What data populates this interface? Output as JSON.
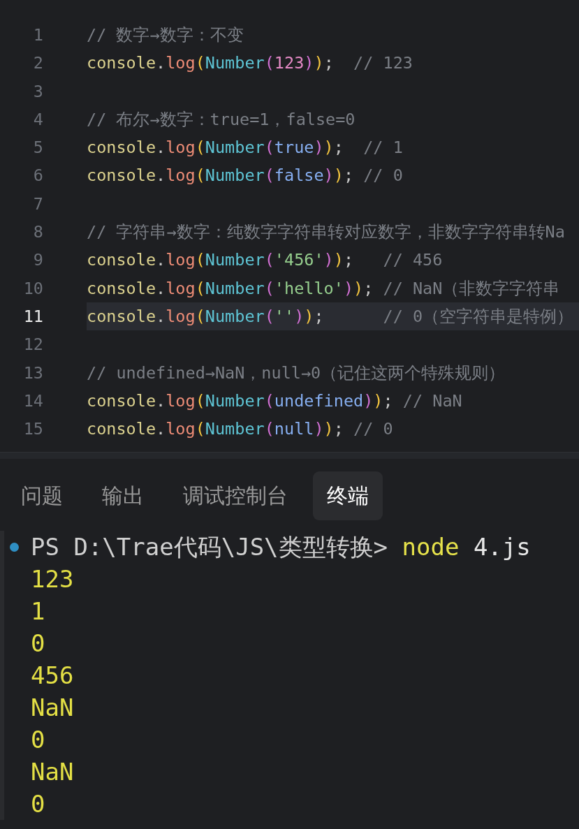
{
  "editor": {
    "lines": [
      {
        "number": "1",
        "active": false,
        "tokens": [
          {
            "kind": "comment",
            "text": "// 数字→数字：不变"
          }
        ]
      },
      {
        "number": "2",
        "active": false,
        "tokens": [
          {
            "kind": "object",
            "text": "console"
          },
          {
            "kind": "punct",
            "text": "."
          },
          {
            "kind": "method",
            "text": "log"
          },
          {
            "kind": "paren",
            "text": "("
          },
          {
            "kind": "func",
            "text": "Number"
          },
          {
            "kind": "subparen",
            "text": "("
          },
          {
            "kind": "number",
            "text": "123"
          },
          {
            "kind": "subparen",
            "text": ")"
          },
          {
            "kind": "paren",
            "text": ")"
          },
          {
            "kind": "punct",
            "text": ";"
          },
          {
            "kind": "comment",
            "text": "  // 123"
          }
        ]
      },
      {
        "number": "3",
        "active": false
      },
      {
        "number": "4",
        "active": false,
        "tokens": [
          {
            "kind": "comment",
            "text": "// 布尔→数字：true=1，false=0"
          }
        ]
      },
      {
        "number": "5",
        "active": false,
        "tokens": [
          {
            "kind": "object",
            "text": "console"
          },
          {
            "kind": "punct",
            "text": "."
          },
          {
            "kind": "method",
            "text": "log"
          },
          {
            "kind": "paren",
            "text": "("
          },
          {
            "kind": "func",
            "text": "Number"
          },
          {
            "kind": "subparen",
            "text": "("
          },
          {
            "kind": "literal",
            "text": "true"
          },
          {
            "kind": "subparen",
            "text": ")"
          },
          {
            "kind": "paren",
            "text": ")"
          },
          {
            "kind": "punct",
            "text": ";"
          },
          {
            "kind": "comment",
            "text": "  // 1"
          }
        ]
      },
      {
        "number": "6",
        "active": false,
        "tokens": [
          {
            "kind": "object",
            "text": "console"
          },
          {
            "kind": "punct",
            "text": "."
          },
          {
            "kind": "method",
            "text": "log"
          },
          {
            "kind": "paren",
            "text": "("
          },
          {
            "kind": "func",
            "text": "Number"
          },
          {
            "kind": "subparen",
            "text": "("
          },
          {
            "kind": "literal",
            "text": "false"
          },
          {
            "kind": "subparen",
            "text": ")"
          },
          {
            "kind": "paren",
            "text": ")"
          },
          {
            "kind": "punct",
            "text": ";"
          },
          {
            "kind": "comment",
            "text": " // 0"
          }
        ]
      },
      {
        "number": "7",
        "active": false
      },
      {
        "number": "8",
        "active": false,
        "tokens": [
          {
            "kind": "comment",
            "text": "// 字符串→数字：纯数字字符串转对应数字，非数字字符串转Na"
          }
        ]
      },
      {
        "number": "9",
        "active": false,
        "tokens": [
          {
            "kind": "object",
            "text": "console"
          },
          {
            "kind": "punct",
            "text": "."
          },
          {
            "kind": "method",
            "text": "log"
          },
          {
            "kind": "paren",
            "text": "("
          },
          {
            "kind": "func",
            "text": "Number"
          },
          {
            "kind": "subparen",
            "text": "("
          },
          {
            "kind": "string",
            "text": "'456'"
          },
          {
            "kind": "subparen",
            "text": ")"
          },
          {
            "kind": "paren",
            "text": ")"
          },
          {
            "kind": "punct",
            "text": ";"
          },
          {
            "kind": "comment",
            "text": "   // 456"
          }
        ]
      },
      {
        "number": "10",
        "active": false,
        "tokens": [
          {
            "kind": "object",
            "text": "console"
          },
          {
            "kind": "punct",
            "text": "."
          },
          {
            "kind": "method",
            "text": "log"
          },
          {
            "kind": "paren",
            "text": "("
          },
          {
            "kind": "func",
            "text": "Number"
          },
          {
            "kind": "subparen",
            "text": "("
          },
          {
            "kind": "string",
            "text": "'hello'"
          },
          {
            "kind": "subparen",
            "text": ")"
          },
          {
            "kind": "paren",
            "text": ")"
          },
          {
            "kind": "punct",
            "text": ";"
          },
          {
            "kind": "comment",
            "text": " // NaN（非数字字符串"
          }
        ]
      },
      {
        "number": "11",
        "active": true,
        "tokens": [
          {
            "kind": "object",
            "text": "console"
          },
          {
            "kind": "punct",
            "text": "."
          },
          {
            "kind": "method",
            "text": "log"
          },
          {
            "kind": "paren",
            "text": "("
          },
          {
            "kind": "func",
            "text": "Number"
          },
          {
            "kind": "subparen",
            "text": "("
          },
          {
            "kind": "string",
            "text": "''"
          },
          {
            "kind": "subparen",
            "text": ")"
          },
          {
            "kind": "paren",
            "text": ")"
          },
          {
            "kind": "punct",
            "text": ";"
          },
          {
            "kind": "comment",
            "text": "      // 0（空字符串是特例）"
          }
        ]
      },
      {
        "number": "12",
        "active": false
      },
      {
        "number": "13",
        "active": false,
        "tokens": [
          {
            "kind": "comment",
            "text": "// undefined→NaN，null→0（记住这两个特殊规则）"
          }
        ]
      },
      {
        "number": "14",
        "active": false,
        "tokens": [
          {
            "kind": "object",
            "text": "console"
          },
          {
            "kind": "punct",
            "text": "."
          },
          {
            "kind": "method",
            "text": "log"
          },
          {
            "kind": "paren",
            "text": "("
          },
          {
            "kind": "func",
            "text": "Number"
          },
          {
            "kind": "subparen",
            "text": "("
          },
          {
            "kind": "literal",
            "text": "undefined"
          },
          {
            "kind": "subparen",
            "text": ")"
          },
          {
            "kind": "paren",
            "text": ")"
          },
          {
            "kind": "punct",
            "text": ";"
          },
          {
            "kind": "comment",
            "text": " // NaN"
          }
        ]
      },
      {
        "number": "15",
        "active": false,
        "tokens": [
          {
            "kind": "object",
            "text": "console"
          },
          {
            "kind": "punct",
            "text": "."
          },
          {
            "kind": "method",
            "text": "log"
          },
          {
            "kind": "paren",
            "text": "("
          },
          {
            "kind": "func",
            "text": "Number"
          },
          {
            "kind": "subparen",
            "text": "("
          },
          {
            "kind": "literal",
            "text": "null"
          },
          {
            "kind": "subparen",
            "text": ")"
          },
          {
            "kind": "paren",
            "text": ")"
          },
          {
            "kind": "punct",
            "text": ";"
          },
          {
            "kind": "comment",
            "text": " // 0"
          }
        ]
      }
    ]
  },
  "panel": {
    "tabs": [
      {
        "label": "问题",
        "selected": false
      },
      {
        "label": "输出",
        "selected": false
      },
      {
        "label": "调试控制台",
        "selected": false
      },
      {
        "label": "终端",
        "selected": true
      }
    ]
  },
  "terminal": {
    "prompt": {
      "tokens": [
        {
          "kind": "prompt",
          "text": "PS D:\\Trae代码\\JS\\类型转换> "
        },
        {
          "kind": "command",
          "text": "node"
        },
        {
          "kind": "argument",
          "text": " 4.js"
        }
      ]
    },
    "output": [
      "123",
      "1",
      "0",
      "456",
      "NaN",
      "0",
      "NaN",
      "0"
    ]
  }
}
